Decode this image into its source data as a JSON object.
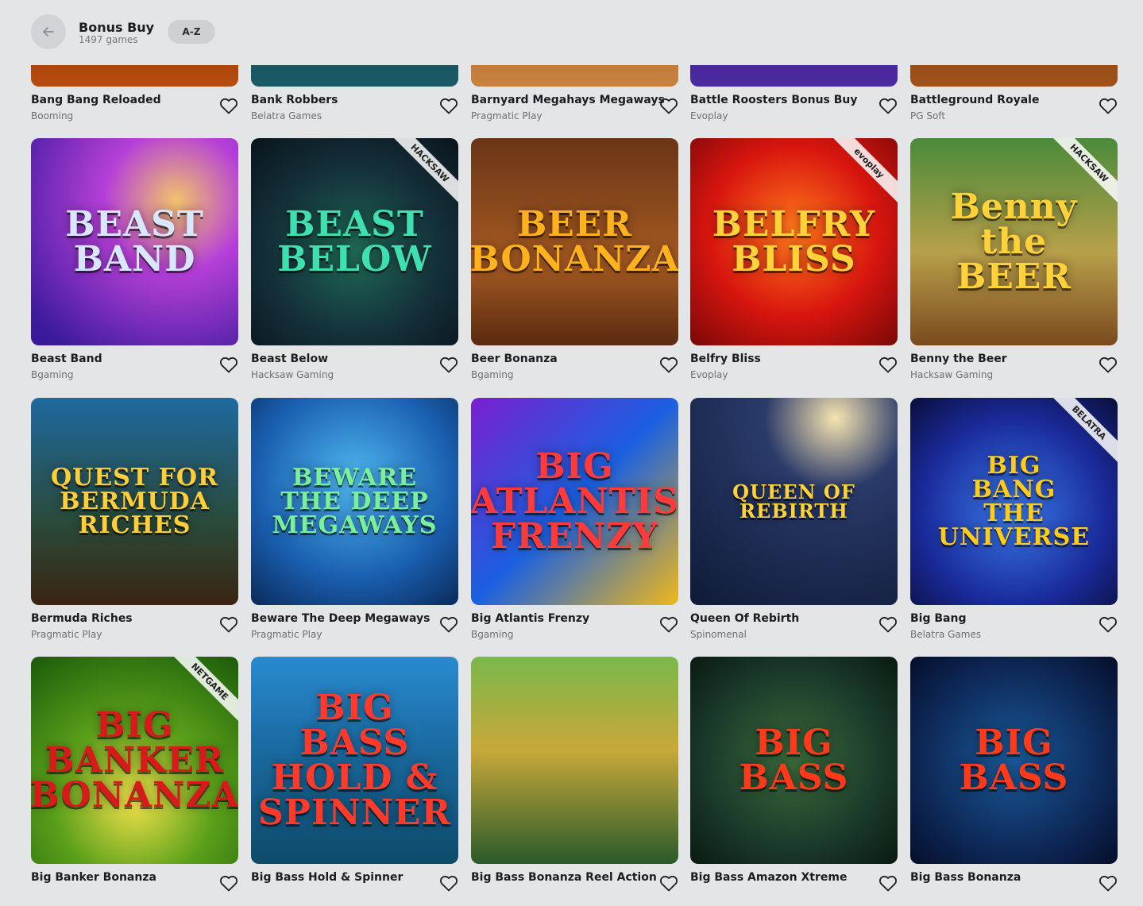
{
  "header": {
    "title": "Bonus Buy",
    "count": "1497 games",
    "sort_label": "A-Z"
  },
  "rows": [
    [
      {
        "name": "Bang Bang Reloaded",
        "provider": "Booming",
        "bg": "linear-gradient(180deg,#4a1406,#b84c0e)"
      },
      {
        "name": "Bank Robbers",
        "provider": "Belatra Games",
        "bg": "linear-gradient(180deg,#0d2f3a,#1a5a66)"
      },
      {
        "name": "Barnyard Megahays Megaways",
        "provider": "Pragmatic Play",
        "bg": "linear-gradient(180deg,#7a4520,#c9823f)"
      },
      {
        "name": "Battle Roosters Bonus Buy",
        "provider": "Evoplay",
        "bg": "linear-gradient(180deg,#2a1460,#4c2aa0)"
      },
      {
        "name": "Battleground Royale",
        "provider": "PG Soft",
        "bg": "linear-gradient(180deg,#4a2a0a,#a0521a)"
      }
    ],
    [
      {
        "name": "Beast Band",
        "provider": "Bgaming",
        "art": "BEAST\nBAND",
        "ribbon": "",
        "bg": "radial-gradient(circle at 70% 30%,#f2c36a 0%,#b53fd8 35%,#3a1a9a 90%)",
        "fg": "#d8e6ff"
      },
      {
        "name": "Beast Below",
        "provider": "Hacksaw Gaming",
        "art": "BEAST\nBELOW",
        "ribbon": "HACKSAW",
        "bg": "radial-gradient(circle at 50% 55%,#1f6a55 0%,#14303a 55%,#0a141c 100%)",
        "fg": "#3fe0b0"
      },
      {
        "name": "Beer Bonanza",
        "provider": "Bgaming",
        "art": "BEER\nBONANZA",
        "ribbon": "",
        "bg": "linear-gradient(180deg,#6a3516 0%,#a55a22 60%,#5a2a10 100%)",
        "fg": "#ffb21e"
      },
      {
        "name": "Belfry Bliss",
        "provider": "Evoplay",
        "art": "BELFRY\nBLISS",
        "ribbon": "evoplay",
        "bg": "radial-gradient(circle at 50% 45%,#ff7a1a 0%,#d8150f 55%,#7a0808 100%)",
        "fg": "#ffd23a"
      },
      {
        "name": "Benny the Beer",
        "provider": "Hacksaw Gaming",
        "art": "Benny\nthe BEER",
        "ribbon": "HACKSAW",
        "bg": "linear-gradient(180deg,#4a8a3a 0%,#b8a04a 55%,#7a4a1e 100%)",
        "fg": "#ffd23a"
      }
    ],
    [
      {
        "name": "Bermuda Riches",
        "provider": "Pragmatic Play",
        "art": "QUEST FOR\nBERMUDA\nRICHES",
        "ribbon": "",
        "bg": "linear-gradient(180deg,#1f6aa0 0%,#2a4a3a 60%,#3a2412 100%)",
        "fg": "#ffcf3a"
      },
      {
        "name": "Beware The Deep Megaways",
        "provider": "Pragmatic Play",
        "art": "BEWARE\nTHE DEEP\nMEGAWAYS",
        "ribbon": "",
        "bg": "radial-gradient(circle at 50% 40%,#4fb8f0 0%,#1a5fb0 60%,#0a2a5a 100%)",
        "fg": "#7af09a"
      },
      {
        "name": "Big Atlantis Frenzy",
        "provider": "Bgaming",
        "art": "BIG ATLANTIS\nFRENZY",
        "ribbon": "",
        "bg": "linear-gradient(135deg,#7a1fd0 0%,#1a60e0 50%,#f0b81a 100%)",
        "fg": "#ff3a3a"
      },
      {
        "name": "Queen Of Rebirth",
        "provider": "Spinomenal",
        "art": "QUEEN OF REBIRTH",
        "ribbon": "",
        "bg": "radial-gradient(circle at 70% 10%,#f6e4b0 0%,#2a3a6a 30%,#0e1a36 100%)",
        "fg": "#ffd23a"
      },
      {
        "name": "Big Bang",
        "provider": "Belatra Games",
        "art": "BIG\nBANG\nTHE UNIVERSE",
        "ribbon": "BELATRA",
        "bg": "radial-gradient(circle at 50% 55%,#3a7ae8 0%,#1a2a9a 60%,#0a0e3a 100%)",
        "fg": "#ffcc1a"
      }
    ],
    [
      {
        "name": "Big Banker Bonanza",
        "provider": "",
        "art": "BIG BANKER\nBONANZA",
        "ribbon": "NETGAME",
        "bg": "radial-gradient(circle at 50% 70%,#f0e04a 0%,#5aa01a 45%,#1a5a0a 100%)",
        "fg": "#d81a1a"
      },
      {
        "name": "Big Bass Hold & Spinner",
        "provider": "",
        "art": "BIG BASS\nHOLD & SPINNER",
        "ribbon": "",
        "bg": "linear-gradient(180deg,#2a8ad0 0%,#1a6aa0 45%,#0e4a6a 100%)",
        "fg": "#ff3a2a"
      },
      {
        "name": "Big Bass Bonanza Reel Action",
        "provider": "",
        "art": "",
        "ribbon": "",
        "bg": "linear-gradient(180deg,#7ab84a 0%,#c8a83a 45%,#2a5a2a 100%)",
        "fg": "#ffd23a"
      },
      {
        "name": "Big Bass Amazon Xtreme",
        "provider": "",
        "art": "BIG BASS",
        "ribbon": "",
        "bg": "radial-gradient(circle at 50% 50%,#3a6a3a 0%,#1a3a2a 60%,#0a1a12 100%)",
        "fg": "#ff3a1a"
      },
      {
        "name": "Big Bass Bonanza",
        "provider": "",
        "art": "BIG BASS",
        "ribbon": "",
        "bg": "radial-gradient(circle at 50% 50%,#1a5a9a 0%,#0e2a5a 60%,#050e2a 100%)",
        "fg": "#ff3a1a"
      }
    ]
  ]
}
